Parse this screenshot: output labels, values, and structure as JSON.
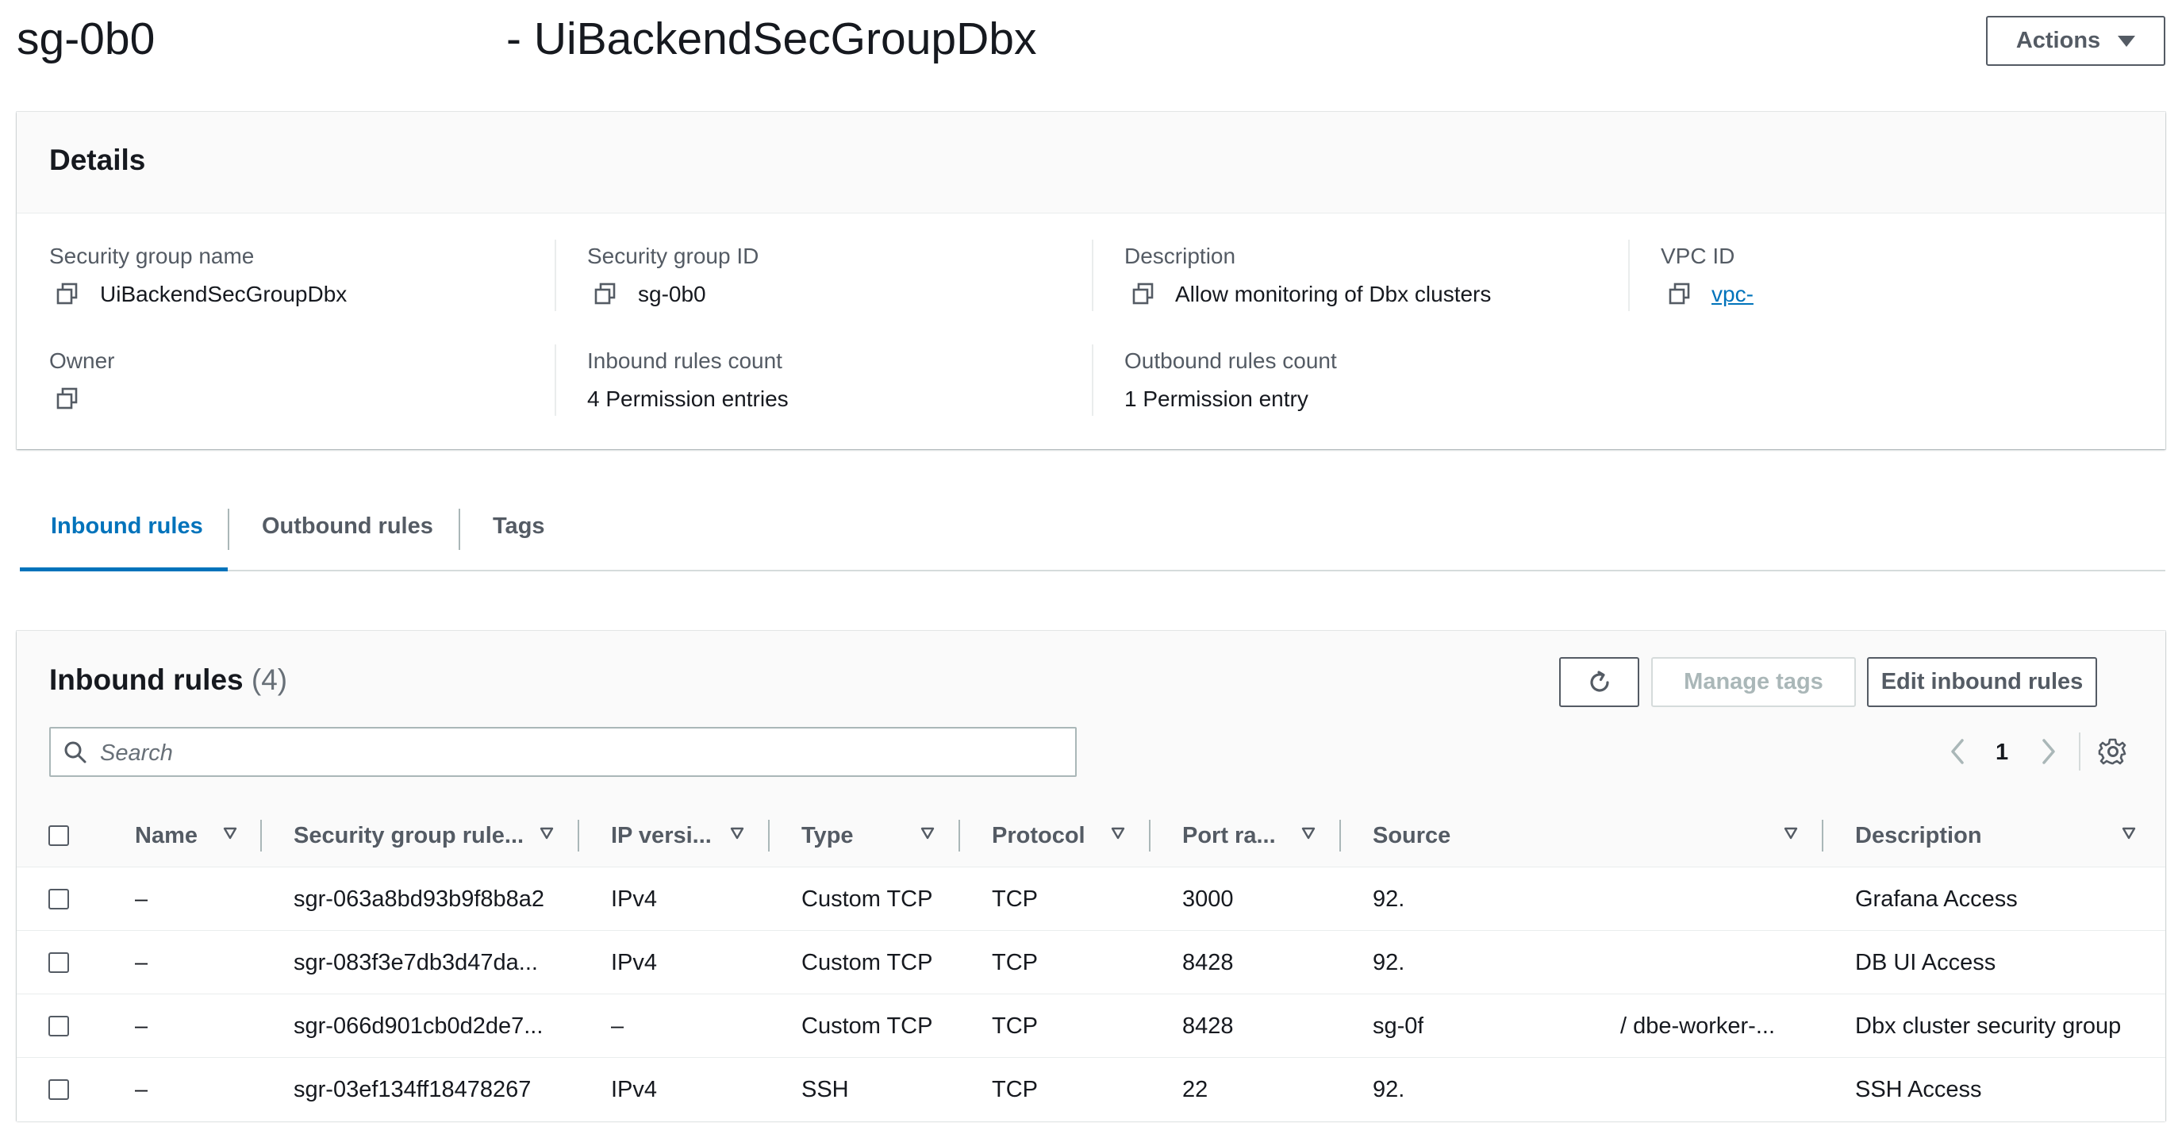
{
  "header": {
    "title_id": "sg-0b0",
    "title_sep": "- UiBackendSecGroupDbx",
    "actions_label": "Actions"
  },
  "details": {
    "title": "Details",
    "fields": {
      "sg_name": {
        "label": "Security group name",
        "value": "UiBackendSecGroupDbx"
      },
      "sg_id": {
        "label": "Security group ID",
        "value": "sg-0b0"
      },
      "description": {
        "label": "Description",
        "value": "Allow monitoring of Dbx clusters"
      },
      "vpc_id": {
        "label": "VPC ID",
        "value": "vpc-"
      },
      "owner": {
        "label": "Owner",
        "value": ""
      },
      "inbound_count": {
        "label": "Inbound rules count",
        "value": "4 Permission entries"
      },
      "outbound_count": {
        "label": "Outbound rules count",
        "value": "1 Permission entry"
      }
    }
  },
  "tabs": [
    {
      "label": "Inbound rules",
      "active": true
    },
    {
      "label": "Outbound rules",
      "active": false
    },
    {
      "label": "Tags",
      "active": false
    }
  ],
  "rules": {
    "title": "Inbound rules",
    "count": "(4)",
    "refresh_icon": "refresh-icon",
    "manage_tags_label": "Manage tags",
    "edit_label": "Edit inbound rules",
    "search_placeholder": "Search",
    "page": "1",
    "columns": [
      "Name",
      "Security group rule...",
      "IP versi...",
      "Type",
      "Protocol",
      "Port ra...",
      "Source",
      "Description"
    ],
    "rows": [
      {
        "name": "–",
        "rule_id": "sgr-063a8bd93b9f8b8a2",
        "ip": "IPv4",
        "type": "Custom TCP",
        "protocol": "TCP",
        "port": "3000",
        "source": "92.",
        "source_extra": "",
        "description": "Grafana Access"
      },
      {
        "name": "–",
        "rule_id": "sgr-083f3e7db3d47da...",
        "ip": "IPv4",
        "type": "Custom TCP",
        "protocol": "TCP",
        "port": "8428",
        "source": "92.",
        "source_extra": "",
        "description": "DB UI Access"
      },
      {
        "name": "–",
        "rule_id": "sgr-066d901cb0d2de7...",
        "ip": "–",
        "type": "Custom TCP",
        "protocol": "TCP",
        "port": "8428",
        "source": "sg-0f",
        "source_extra": "/ dbe-worker-...",
        "description": "Dbx cluster security group"
      },
      {
        "name": "–",
        "rule_id": "sgr-03ef134ff18478267",
        "ip": "IPv4",
        "type": "SSH",
        "protocol": "TCP",
        "port": "22",
        "source": "92.",
        "source_extra": "",
        "description": "SSH Access"
      }
    ]
  },
  "colors": {
    "accent": "#0073bb",
    "text": "#16191f",
    "muted": "#545b64",
    "border": "#eaeded"
  }
}
